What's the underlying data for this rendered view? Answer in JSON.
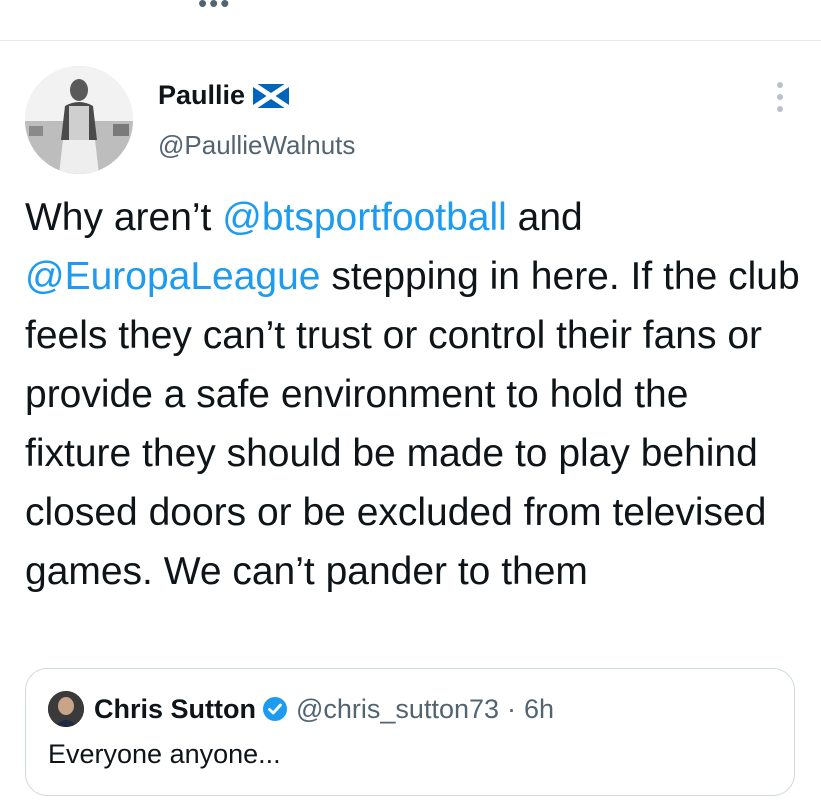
{
  "top_bar": {
    "dots": "•••"
  },
  "author": {
    "display_name": "Paullie",
    "flag_icon": "scotland-flag-icon",
    "handle": "@PaullieWalnuts"
  },
  "tweet": {
    "segments": [
      {
        "text": "Why aren’t ",
        "mention": false
      },
      {
        "text": "@btsportfootball",
        "mention": true
      },
      {
        "text": " and ",
        "mention": false
      },
      {
        "text": "@EuropaLeague",
        "mention": true
      },
      {
        "text": " stepping in here. If the club feels they can’t trust or control their fans or provide a safe environment to hold the fixture they should be made to play behind closed doors or be excluded from televised games. We can’t pander to them",
        "mention": false
      }
    ]
  },
  "quoted": {
    "name": "Chris Sutton",
    "verified_icon": "verified-badge-icon",
    "handle": "@chris_sutton73",
    "separator": "·",
    "time": "6h",
    "text": "Everyone anyone..."
  },
  "colors": {
    "link": "#1d9bf0",
    "text": "#0f1419",
    "secondary": "#536471",
    "border": "#cfd9de"
  }
}
